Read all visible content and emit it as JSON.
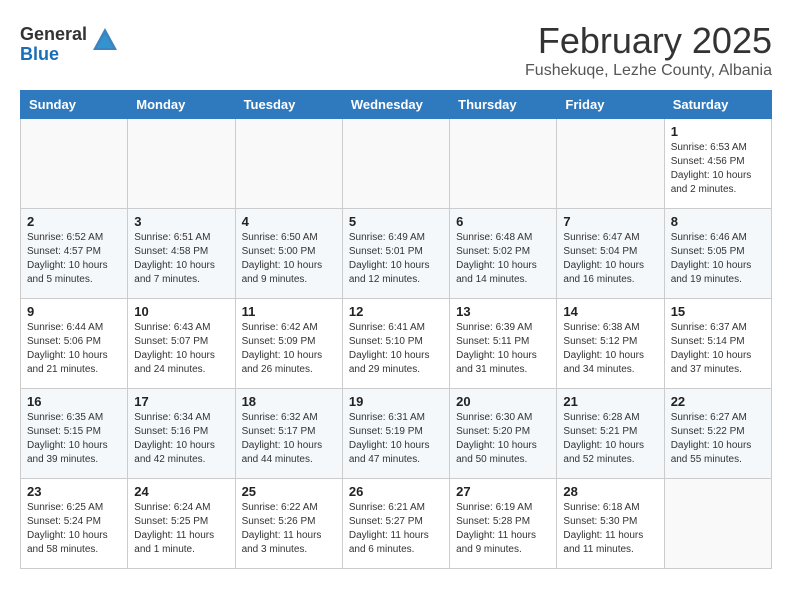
{
  "header": {
    "logo_general": "General",
    "logo_blue": "Blue",
    "title": "February 2025",
    "subtitle": "Fushekuqe, Lezhe County, Albania"
  },
  "weekdays": [
    "Sunday",
    "Monday",
    "Tuesday",
    "Wednesday",
    "Thursday",
    "Friday",
    "Saturday"
  ],
  "weeks": [
    [
      {
        "day": "",
        "info": ""
      },
      {
        "day": "",
        "info": ""
      },
      {
        "day": "",
        "info": ""
      },
      {
        "day": "",
        "info": ""
      },
      {
        "day": "",
        "info": ""
      },
      {
        "day": "",
        "info": ""
      },
      {
        "day": "1",
        "info": "Sunrise: 6:53 AM\nSunset: 4:56 PM\nDaylight: 10 hours\nand 2 minutes."
      }
    ],
    [
      {
        "day": "2",
        "info": "Sunrise: 6:52 AM\nSunset: 4:57 PM\nDaylight: 10 hours\nand 5 minutes."
      },
      {
        "day": "3",
        "info": "Sunrise: 6:51 AM\nSunset: 4:58 PM\nDaylight: 10 hours\nand 7 minutes."
      },
      {
        "day": "4",
        "info": "Sunrise: 6:50 AM\nSunset: 5:00 PM\nDaylight: 10 hours\nand 9 minutes."
      },
      {
        "day": "5",
        "info": "Sunrise: 6:49 AM\nSunset: 5:01 PM\nDaylight: 10 hours\nand 12 minutes."
      },
      {
        "day": "6",
        "info": "Sunrise: 6:48 AM\nSunset: 5:02 PM\nDaylight: 10 hours\nand 14 minutes."
      },
      {
        "day": "7",
        "info": "Sunrise: 6:47 AM\nSunset: 5:04 PM\nDaylight: 10 hours\nand 16 minutes."
      },
      {
        "day": "8",
        "info": "Sunrise: 6:46 AM\nSunset: 5:05 PM\nDaylight: 10 hours\nand 19 minutes."
      }
    ],
    [
      {
        "day": "9",
        "info": "Sunrise: 6:44 AM\nSunset: 5:06 PM\nDaylight: 10 hours\nand 21 minutes."
      },
      {
        "day": "10",
        "info": "Sunrise: 6:43 AM\nSunset: 5:07 PM\nDaylight: 10 hours\nand 24 minutes."
      },
      {
        "day": "11",
        "info": "Sunrise: 6:42 AM\nSunset: 5:09 PM\nDaylight: 10 hours\nand 26 minutes."
      },
      {
        "day": "12",
        "info": "Sunrise: 6:41 AM\nSunset: 5:10 PM\nDaylight: 10 hours\nand 29 minutes."
      },
      {
        "day": "13",
        "info": "Sunrise: 6:39 AM\nSunset: 5:11 PM\nDaylight: 10 hours\nand 31 minutes."
      },
      {
        "day": "14",
        "info": "Sunrise: 6:38 AM\nSunset: 5:12 PM\nDaylight: 10 hours\nand 34 minutes."
      },
      {
        "day": "15",
        "info": "Sunrise: 6:37 AM\nSunset: 5:14 PM\nDaylight: 10 hours\nand 37 minutes."
      }
    ],
    [
      {
        "day": "16",
        "info": "Sunrise: 6:35 AM\nSunset: 5:15 PM\nDaylight: 10 hours\nand 39 minutes."
      },
      {
        "day": "17",
        "info": "Sunrise: 6:34 AM\nSunset: 5:16 PM\nDaylight: 10 hours\nand 42 minutes."
      },
      {
        "day": "18",
        "info": "Sunrise: 6:32 AM\nSunset: 5:17 PM\nDaylight: 10 hours\nand 44 minutes."
      },
      {
        "day": "19",
        "info": "Sunrise: 6:31 AM\nSunset: 5:19 PM\nDaylight: 10 hours\nand 47 minutes."
      },
      {
        "day": "20",
        "info": "Sunrise: 6:30 AM\nSunset: 5:20 PM\nDaylight: 10 hours\nand 50 minutes."
      },
      {
        "day": "21",
        "info": "Sunrise: 6:28 AM\nSunset: 5:21 PM\nDaylight: 10 hours\nand 52 minutes."
      },
      {
        "day": "22",
        "info": "Sunrise: 6:27 AM\nSunset: 5:22 PM\nDaylight: 10 hours\nand 55 minutes."
      }
    ],
    [
      {
        "day": "23",
        "info": "Sunrise: 6:25 AM\nSunset: 5:24 PM\nDaylight: 10 hours\nand 58 minutes."
      },
      {
        "day": "24",
        "info": "Sunrise: 6:24 AM\nSunset: 5:25 PM\nDaylight: 11 hours\nand 1 minute."
      },
      {
        "day": "25",
        "info": "Sunrise: 6:22 AM\nSunset: 5:26 PM\nDaylight: 11 hours\nand 3 minutes."
      },
      {
        "day": "26",
        "info": "Sunrise: 6:21 AM\nSunset: 5:27 PM\nDaylight: 11 hours\nand 6 minutes."
      },
      {
        "day": "27",
        "info": "Sunrise: 6:19 AM\nSunset: 5:28 PM\nDaylight: 11 hours\nand 9 minutes."
      },
      {
        "day": "28",
        "info": "Sunrise: 6:18 AM\nSunset: 5:30 PM\nDaylight: 11 hours\nand 11 minutes."
      },
      {
        "day": "",
        "info": ""
      }
    ]
  ]
}
